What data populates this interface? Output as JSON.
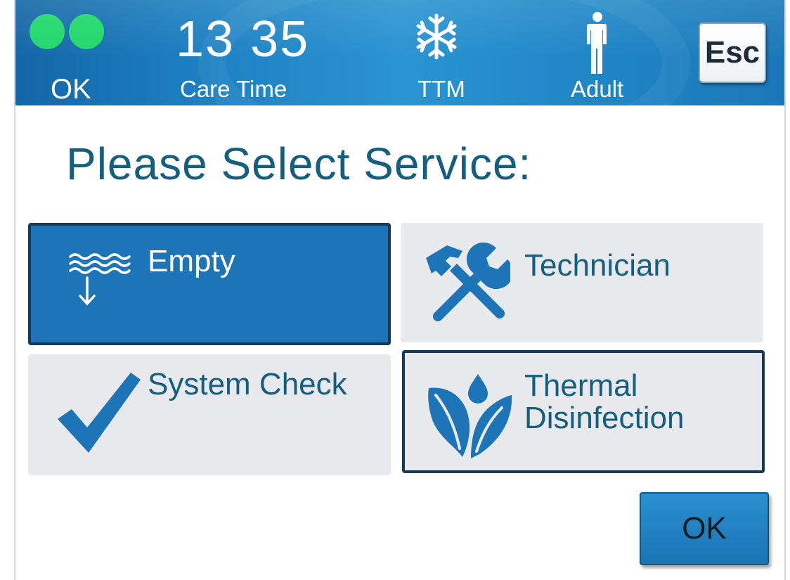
{
  "header": {
    "status_label": "OK",
    "status_color": "#22d86c",
    "clock": "13 35",
    "clock_label": "Care Time",
    "mode_icon": "snowflake-icon",
    "mode_label": "TTM",
    "patient_icon": "adult-person-icon",
    "patient_label": "Adult",
    "esc_label": "Esc"
  },
  "main": {
    "title": "Please Select Service:",
    "services": [
      {
        "label": "Empty",
        "icon": "drain-water-icon",
        "selected": true
      },
      {
        "label": "Technician",
        "icon": "tools-icon",
        "selected": false
      },
      {
        "label": "System Check",
        "icon": "checkmark-icon",
        "selected": false
      },
      {
        "label_line1": "Thermal",
        "label_line2": "Disinfection",
        "icon": "leaves-droplet-icon",
        "focused": true
      }
    ],
    "ok_label": "OK"
  },
  "colors": {
    "header_blue": "#1c7ec0",
    "accent_blue": "#1d74b6",
    "title_blue": "#145e80",
    "tile_gray": "#e7e9ec",
    "status_green": "#22d86c"
  }
}
